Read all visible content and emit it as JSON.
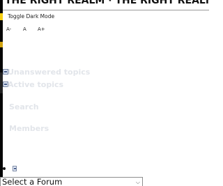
{
  "header": {
    "title": "THE RIGHT REALM · THE RIGHT REALM"
  },
  "controls": {
    "toggle_dark_mode": "Toggle Dark Mode",
    "font_size": {
      "decrease": "A-",
      "normal": "A",
      "increase": "A+"
    }
  },
  "nav": {
    "unanswered_topics": "Unanswered topics",
    "active_topics": "Active topics",
    "search": "Search",
    "members": "Members"
  },
  "forum_select": {
    "selected": "Select a Forum"
  },
  "colors": {
    "page_background": "#ffffff",
    "left_strip": "#050505",
    "accent_yellow": "#f5ce12",
    "faded_nav_text": "#e2e5ea",
    "rule": "#9a9a9a"
  }
}
